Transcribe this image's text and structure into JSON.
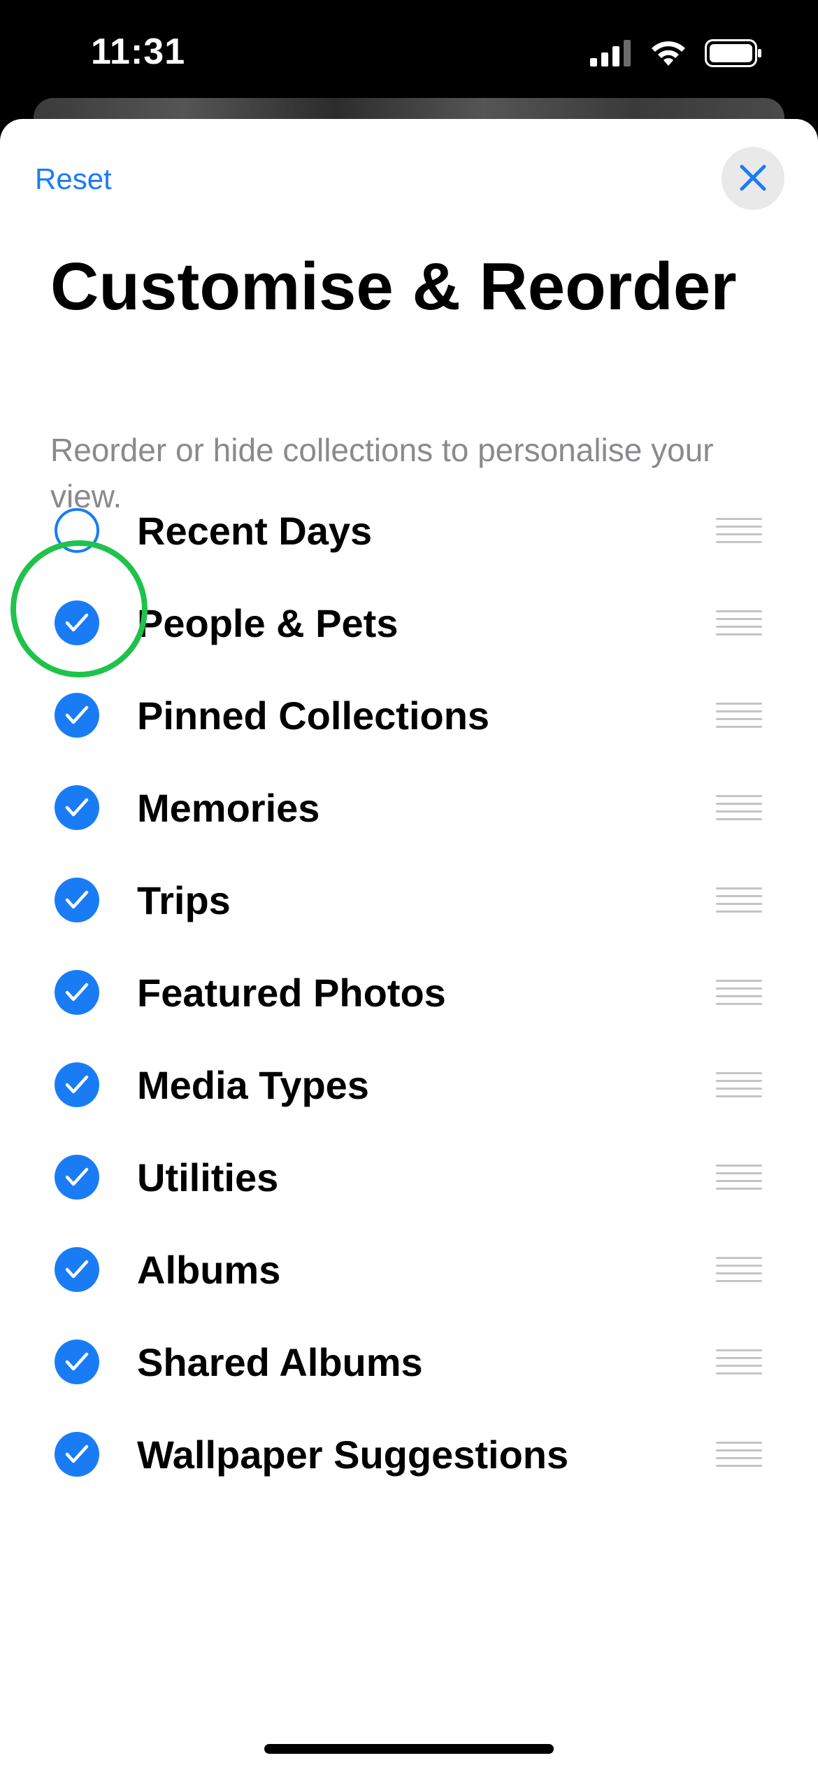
{
  "status_bar": {
    "time": "11:31",
    "icons": [
      "signal-icon",
      "wifi-icon",
      "battery-icon"
    ]
  },
  "header": {
    "reset_label": "Reset",
    "close_icon": "close-icon",
    "title": "Customise & Reorder",
    "subtitle": "Reorder or hide collections to personalise your view."
  },
  "colors": {
    "accent": "#1a7cf5",
    "highlight_ring": "#1fc34c",
    "subtitle": "#8a8a8e"
  },
  "collections": [
    {
      "label": "Recent Days",
      "checked": false
    },
    {
      "label": "People & Pets",
      "checked": true
    },
    {
      "label": "Pinned Collections",
      "checked": true
    },
    {
      "label": "Memories",
      "checked": true
    },
    {
      "label": "Trips",
      "checked": true
    },
    {
      "label": "Featured Photos",
      "checked": true
    },
    {
      "label": "Media Types",
      "checked": true
    },
    {
      "label": "Utilities",
      "checked": true
    },
    {
      "label": "Albums",
      "checked": true
    },
    {
      "label": "Shared Albums",
      "checked": true
    },
    {
      "label": "Wallpaper Suggestions",
      "checked": true
    }
  ]
}
